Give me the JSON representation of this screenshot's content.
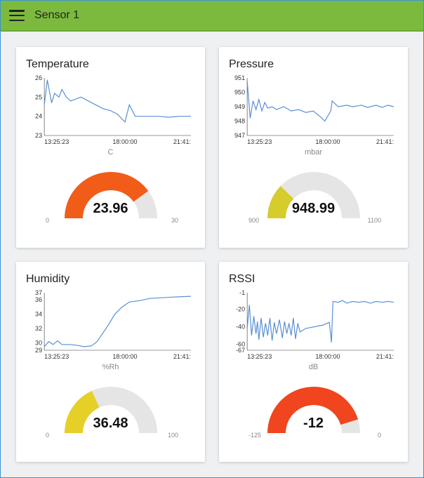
{
  "header": {
    "title": "Sensor 1"
  },
  "cards": [
    {
      "title": "Temperature",
      "unit": "C",
      "gauge": {
        "value": "23.96",
        "min": "0",
        "max": "30",
        "fraction": 0.799,
        "color": "#f25c19"
      },
      "chart_data": {
        "type": "line",
        "x_ticks": [
          "13:25:23",
          "18:00:00",
          "21:41:"
        ],
        "y_ticks": [
          23,
          24,
          25,
          26
        ],
        "ylim": [
          23,
          26
        ],
        "series": [
          {
            "name": "Temperature",
            "values": [
              [
                0,
                24.6
              ],
              [
                0.02,
                25.9
              ],
              [
                0.05,
                24.7
              ],
              [
                0.07,
                25.2
              ],
              [
                0.1,
                25.0
              ],
              [
                0.12,
                25.4
              ],
              [
                0.15,
                25.0
              ],
              [
                0.18,
                24.8
              ],
              [
                0.25,
                25.0
              ],
              [
                0.3,
                24.8
              ],
              [
                0.35,
                24.6
              ],
              [
                0.4,
                24.4
              ],
              [
                0.45,
                24.3
              ],
              [
                0.5,
                24.1
              ],
              [
                0.55,
                23.7
              ],
              [
                0.58,
                24.6
              ],
              [
                0.62,
                24.0
              ],
              [
                0.7,
                24.0
              ],
              [
                0.78,
                24.0
              ],
              [
                0.85,
                23.95
              ],
              [
                0.92,
                24.0
              ],
              [
                1.0,
                24.0
              ]
            ]
          }
        ]
      }
    },
    {
      "title": "Pressure",
      "unit": "mbar",
      "gauge": {
        "value": "948.99",
        "min": "900",
        "max": "1100",
        "fraction": 0.245,
        "color": "#d6cc2c"
      },
      "chart_data": {
        "type": "line",
        "x_ticks": [
          "13:25:23",
          "18:00:00",
          "21:41:"
        ],
        "y_ticks": [
          947,
          948,
          949,
          950,
          951
        ],
        "ylim": [
          947,
          951
        ],
        "series": [
          {
            "name": "Pressure",
            "values": [
              [
                0,
                950.8
              ],
              [
                0.02,
                948.2
              ],
              [
                0.04,
                949.4
              ],
              [
                0.06,
                948.8
              ],
              [
                0.08,
                949.5
              ],
              [
                0.1,
                948.7
              ],
              [
                0.12,
                949.3
              ],
              [
                0.14,
                948.9
              ],
              [
                0.17,
                949.0
              ],
              [
                0.2,
                948.8
              ],
              [
                0.25,
                949.0
              ],
              [
                0.3,
                948.7
              ],
              [
                0.35,
                948.8
              ],
              [
                0.4,
                948.6
              ],
              [
                0.45,
                948.7
              ],
              [
                0.5,
                948.3
              ],
              [
                0.53,
                948.0
              ],
              [
                0.57,
                948.7
              ],
              [
                0.58,
                949.4
              ],
              [
                0.62,
                949.0
              ],
              [
                0.68,
                949.1
              ],
              [
                0.72,
                949.0
              ],
              [
                0.78,
                949.1
              ],
              [
                0.82,
                948.95
              ],
              [
                0.88,
                949.1
              ],
              [
                0.92,
                948.95
              ],
              [
                0.96,
                949.1
              ],
              [
                1.0,
                949.0
              ]
            ]
          }
        ]
      }
    },
    {
      "title": "Humidity",
      "unit": "%Rh",
      "gauge": {
        "value": "36.48",
        "min": "0",
        "max": "100",
        "fraction": 0.3648,
        "color": "#e6d028"
      },
      "chart_data": {
        "type": "line",
        "x_ticks": [
          "13:25:23",
          "18:00:00",
          "21:41:"
        ],
        "y_ticks": [
          29,
          30,
          32,
          34,
          36,
          37
        ],
        "ylim": [
          29,
          37
        ],
        "series": [
          {
            "name": "Humidity",
            "values": [
              [
                0,
                29.5
              ],
              [
                0.03,
                30.2
              ],
              [
                0.06,
                29.8
              ],
              [
                0.09,
                30.3
              ],
              [
                0.12,
                29.8
              ],
              [
                0.17,
                29.8
              ],
              [
                0.22,
                29.7
              ],
              [
                0.27,
                29.5
              ],
              [
                0.32,
                29.6
              ],
              [
                0.36,
                30.2
              ],
              [
                0.4,
                31.4
              ],
              [
                0.44,
                32.6
              ],
              [
                0.48,
                34.0
              ],
              [
                0.53,
                35.0
              ],
              [
                0.58,
                35.7
              ],
              [
                0.65,
                35.9
              ],
              [
                0.72,
                36.2
              ],
              [
                0.8,
                36.3
              ],
              [
                0.88,
                36.4
              ],
              [
                1.0,
                36.5
              ]
            ]
          }
        ]
      }
    },
    {
      "title": "RSSI",
      "unit": "dB",
      "gauge": {
        "value": "-12",
        "min": "-125",
        "max": "0",
        "fraction": 0.904,
        "color": "#f0451e"
      },
      "chart_data": {
        "type": "line",
        "x_ticks": [
          "13:25:23",
          "18:00:00",
          "21:41:"
        ],
        "y_ticks": [
          -67,
          -60,
          -40,
          -20,
          -1
        ],
        "ylim": [
          -67,
          -1
        ],
        "series": [
          {
            "name": "RSSI",
            "values": [
              [
                0,
                -42
              ],
              [
                0.015,
                -15
              ],
              [
                0.03,
                -50
              ],
              [
                0.045,
                -28
              ],
              [
                0.06,
                -48
              ],
              [
                0.07,
                -34
              ],
              [
                0.08,
                -55
              ],
              [
                0.095,
                -30
              ],
              [
                0.11,
                -52
              ],
              [
                0.125,
                -36
              ],
              [
                0.14,
                -50
              ],
              [
                0.155,
                -30
              ],
              [
                0.17,
                -56
              ],
              [
                0.185,
                -35
              ],
              [
                0.2,
                -48
              ],
              [
                0.22,
                -32
              ],
              [
                0.24,
                -53
              ],
              [
                0.255,
                -34
              ],
              [
                0.27,
                -48
              ],
              [
                0.285,
                -36
              ],
              [
                0.3,
                -50
              ],
              [
                0.315,
                -30
              ],
              [
                0.33,
                -54
              ],
              [
                0.345,
                -36
              ],
              [
                0.36,
                -46
              ],
              [
                0.4,
                -42
              ],
              [
                0.46,
                -40
              ],
              [
                0.52,
                -38
              ],
              [
                0.56,
                -35
              ],
              [
                0.575,
                -58
              ],
              [
                0.585,
                -11
              ],
              [
                0.62,
                -12
              ],
              [
                0.65,
                -10
              ],
              [
                0.68,
                -13
              ],
              [
                0.72,
                -11
              ],
              [
                0.76,
                -12
              ],
              [
                0.8,
                -11
              ],
              [
                0.84,
                -13
              ],
              [
                0.88,
                -11
              ],
              [
                0.92,
                -12
              ],
              [
                0.96,
                -11
              ],
              [
                1.0,
                -12
              ]
            ]
          }
        ]
      }
    }
  ]
}
